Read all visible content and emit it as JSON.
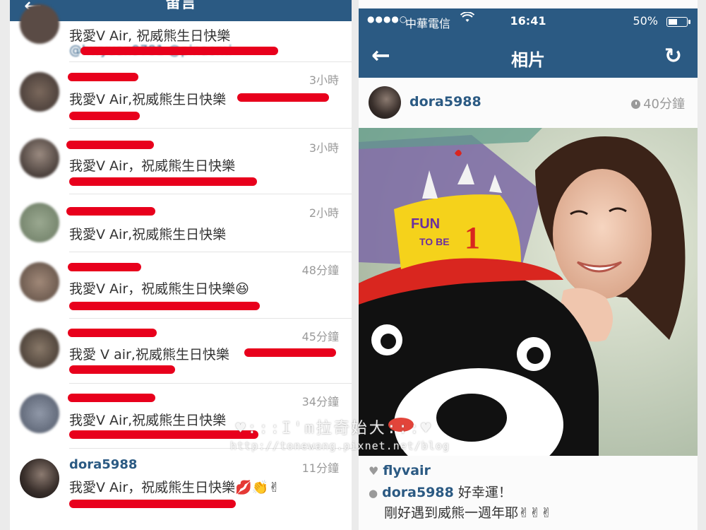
{
  "left_panel": {
    "title": "留言",
    "back_icon": "←",
    "comments": [
      {
        "username": "",
        "time": "",
        "text": "我愛V Air, 祝威熊生日快樂",
        "mention": "@hwyuan9781 @pinaomi",
        "emoji": ""
      },
      {
        "username": "",
        "time": "3小時",
        "text": "我愛V Air,祝威熊生日快樂",
        "mention": "",
        "emoji": ""
      },
      {
        "username": "",
        "time": "3小時",
        "text": "我愛V Air，祝威熊生日快樂",
        "mention": "",
        "emoji": ""
      },
      {
        "username": "",
        "time": "2小時",
        "text": "我愛V Air,祝威熊生日快樂",
        "mention": "",
        "emoji": ""
      },
      {
        "username": "",
        "time": "48分鐘",
        "text": "我愛V Air，祝威熊生日快樂",
        "mention": "",
        "emoji": "😆"
      },
      {
        "username": "",
        "time": "45分鐘",
        "text": "我愛 V air,祝威熊生日快樂",
        "mention": "",
        "emoji": ""
      },
      {
        "username": "",
        "time": "34分鐘",
        "text": "我愛V Air,祝威熊生日快樂",
        "mention": "",
        "emoji": ""
      },
      {
        "username": "dora5988",
        "time": "11分鐘",
        "text": "我愛V Air，祝威熊生日快樂",
        "mention": "",
        "emoji": "💋👏✌"
      }
    ]
  },
  "status_bar": {
    "signal": "●●●●○",
    "carrier": "中華電信",
    "time": "16:41",
    "battery": "50%",
    "battery_level": 0.5
  },
  "nav": {
    "back_icon": "←",
    "title": "相片",
    "refresh_icon": "↻"
  },
  "post": {
    "username": "dora5988",
    "time": "40分鐘",
    "photo": {
      "hat_text_1": "FUN",
      "hat_text_2": "TO BE",
      "hat_number": "1"
    },
    "watermark_1": "♥:::I'm拉奇始大:::♥",
    "watermark_2": "http://tonewang.pixnet.net/blog",
    "likes": "flyvair",
    "comment_user": "dora5988",
    "comment_text": "好幸運！",
    "comment_text_2": "剛好遇到威熊一週年耶✌✌✌"
  }
}
